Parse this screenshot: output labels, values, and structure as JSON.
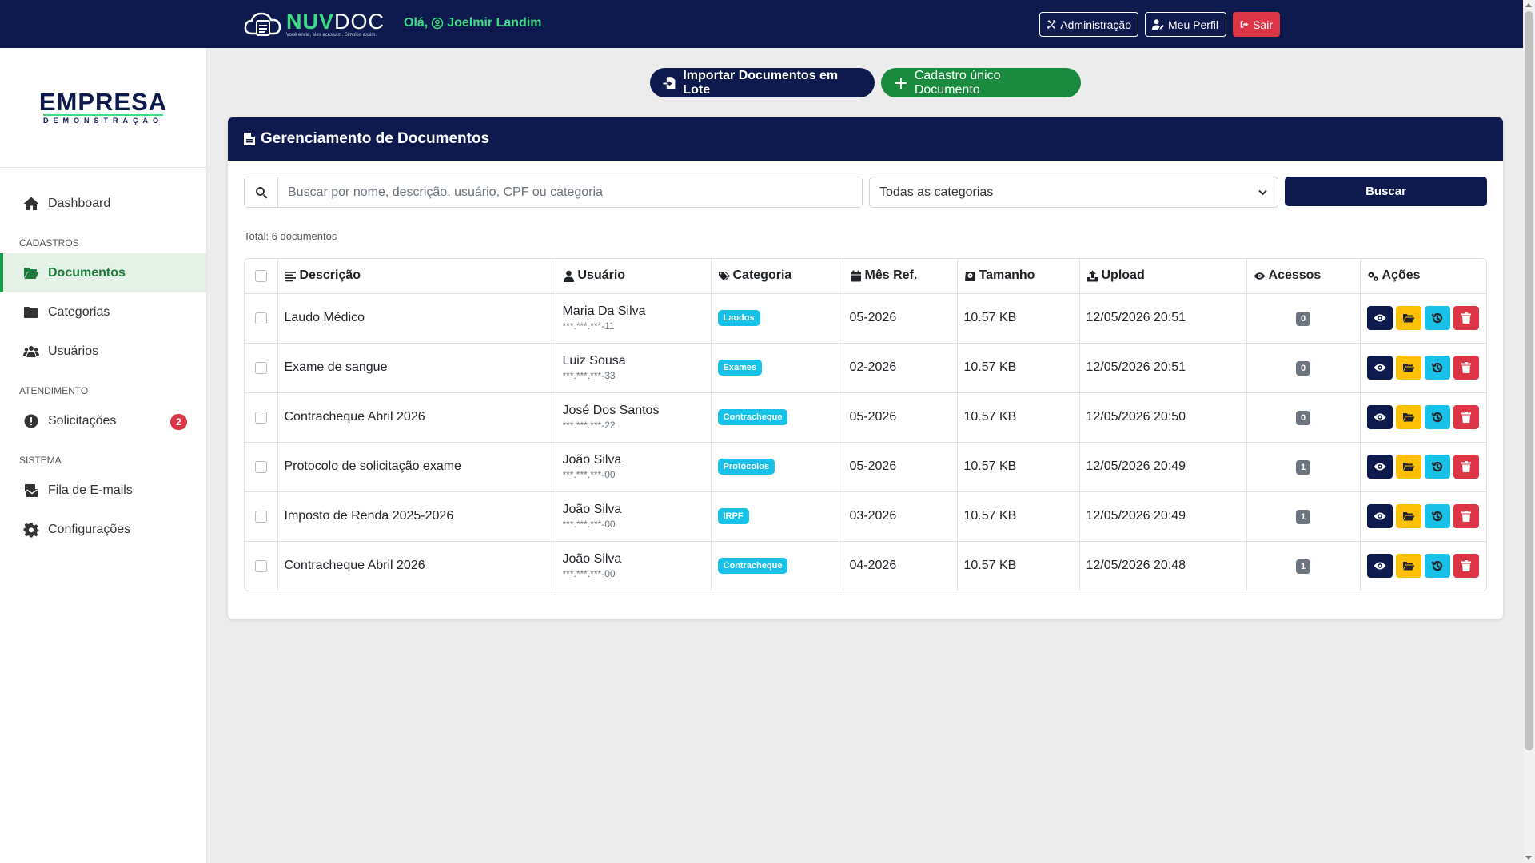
{
  "topbar": {
    "logo_nuv": "NUV",
    "logo_doc": "DOC",
    "logo_tagline": "Você envia, eles acessam. Simples assim.",
    "greeting_prefix": "Olá,",
    "greeting_user": "Joelmir Landim",
    "admin_label": "Administração",
    "profile_label": "Meu Perfil",
    "logout_label": "Sair"
  },
  "sidebar": {
    "brand_name": "EMPRESA",
    "brand_sub": "DEMONSTRAÇÃO",
    "dashboard": "Dashboard",
    "section_cadastros": "CADASTROS",
    "documentos": "Documentos",
    "categorias": "Categorias",
    "usuarios": "Usuários",
    "section_atendimento": "ATENDIMENTO",
    "solicitacoes": "Solicitações",
    "solicitacoes_count": "2",
    "section_sistema": "SISTEMA",
    "fila_emails": "Fila de E-mails",
    "configuracoes": "Configurações"
  },
  "actions": {
    "import_label": "Importar Documentos em Lote",
    "cadastro_label": "Cadastro único Documento"
  },
  "card": {
    "title": "Gerenciamento de Documentos",
    "search_placeholder": "Buscar por nome, descrição, usuário, CPF ou categoria",
    "category_selected": "Todas as categorias",
    "search_button": "Buscar",
    "total": "Total: 6 documentos"
  },
  "table": {
    "headers": {
      "descricao": "Descrição",
      "usuario": "Usuário",
      "categoria": "Categoria",
      "mes_ref": "Mês Ref.",
      "tamanho": "Tamanho",
      "upload": "Upload",
      "acessos": "Acessos",
      "acoes": "Ações"
    },
    "rows": [
      {
        "descricao": "Laudo Médico",
        "usuario": "Maria Da Silva",
        "cpf": "***.***.***-11",
        "categoria": "Laudos",
        "mes_ref": "05-2026",
        "tamanho": "10.57 KB",
        "upload": "12/05/2026 20:51",
        "acessos": "0"
      },
      {
        "descricao": "Exame de sangue",
        "usuario": "Luiz Sousa",
        "cpf": "***.***.***-33",
        "categoria": "Exames",
        "mes_ref": "02-2026",
        "tamanho": "10.57 KB",
        "upload": "12/05/2026 20:51",
        "acessos": "0"
      },
      {
        "descricao": "Contracheque Abril 2026",
        "usuario": "José Dos Santos",
        "cpf": "***.***.***-22",
        "categoria": "Contracheque",
        "mes_ref": "05-2026",
        "tamanho": "10.57 KB",
        "upload": "12/05/2026 20:50",
        "acessos": "0"
      },
      {
        "descricao": "Protocolo de solicitação exame",
        "usuario": "João Silva",
        "cpf": "***.***.***-00",
        "categoria": "Protocolos",
        "mes_ref": "05-2026",
        "tamanho": "10.57 KB",
        "upload": "12/05/2026 20:49",
        "acessos": "1"
      },
      {
        "descricao": "Imposto de Renda 2025-2026",
        "usuario": "João Silva",
        "cpf": "***.***.***-00",
        "categoria": "IRPF",
        "mes_ref": "03-2026",
        "tamanho": "10.57 KB",
        "upload": "12/05/2026 20:49",
        "acessos": "1"
      },
      {
        "descricao": "Contracheque Abril 2026",
        "usuario": "João Silva",
        "cpf": "***.***.***-00",
        "categoria": "Contracheque",
        "mes_ref": "04-2026",
        "tamanho": "10.57 KB",
        "upload": "12/05/2026 20:48",
        "acessos": "1"
      }
    ]
  },
  "colors": {
    "navy": "#0e1a4d",
    "green": "#3ddc84",
    "category_badge": "#17c1e8",
    "danger": "#dc3545",
    "warning": "#ffc107"
  }
}
